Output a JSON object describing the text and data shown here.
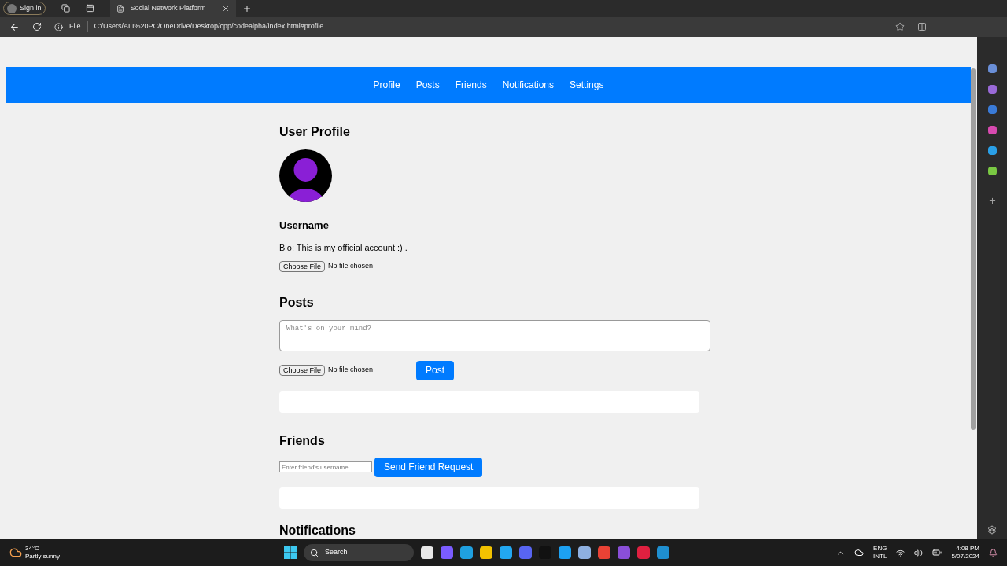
{
  "browser": {
    "profile_button": "Sign in",
    "tab_title": "Social Network Platform",
    "address_scheme": "File",
    "address": "C:/Users/ALI%20PC/OneDrive/Desktop/cpp/codealpha/index.html#profile"
  },
  "nav": [
    "Profile",
    "Posts",
    "Friends",
    "Notifications",
    "Settings"
  ],
  "profile": {
    "title": "User Profile",
    "username": "Username",
    "bio": "Bio: This is my official account :) .",
    "file_button": "Choose File",
    "file_status": "No file chosen"
  },
  "posts": {
    "title": "Posts",
    "placeholder": "What's on your mind?",
    "file_button": "Choose File",
    "file_status": "No file chosen",
    "post_button": "Post"
  },
  "friends": {
    "title": "Friends",
    "placeholder": "Enter friend's username",
    "request_button": "Send Friend Request"
  },
  "notifications": {
    "title": "Notifications"
  },
  "taskbar": {
    "temperature": "34°C",
    "weather": "Partly sunny",
    "search": "Search",
    "lang": "ENG",
    "layout": "INTL",
    "time": "4:08 PM",
    "date": "5/07/2024"
  }
}
